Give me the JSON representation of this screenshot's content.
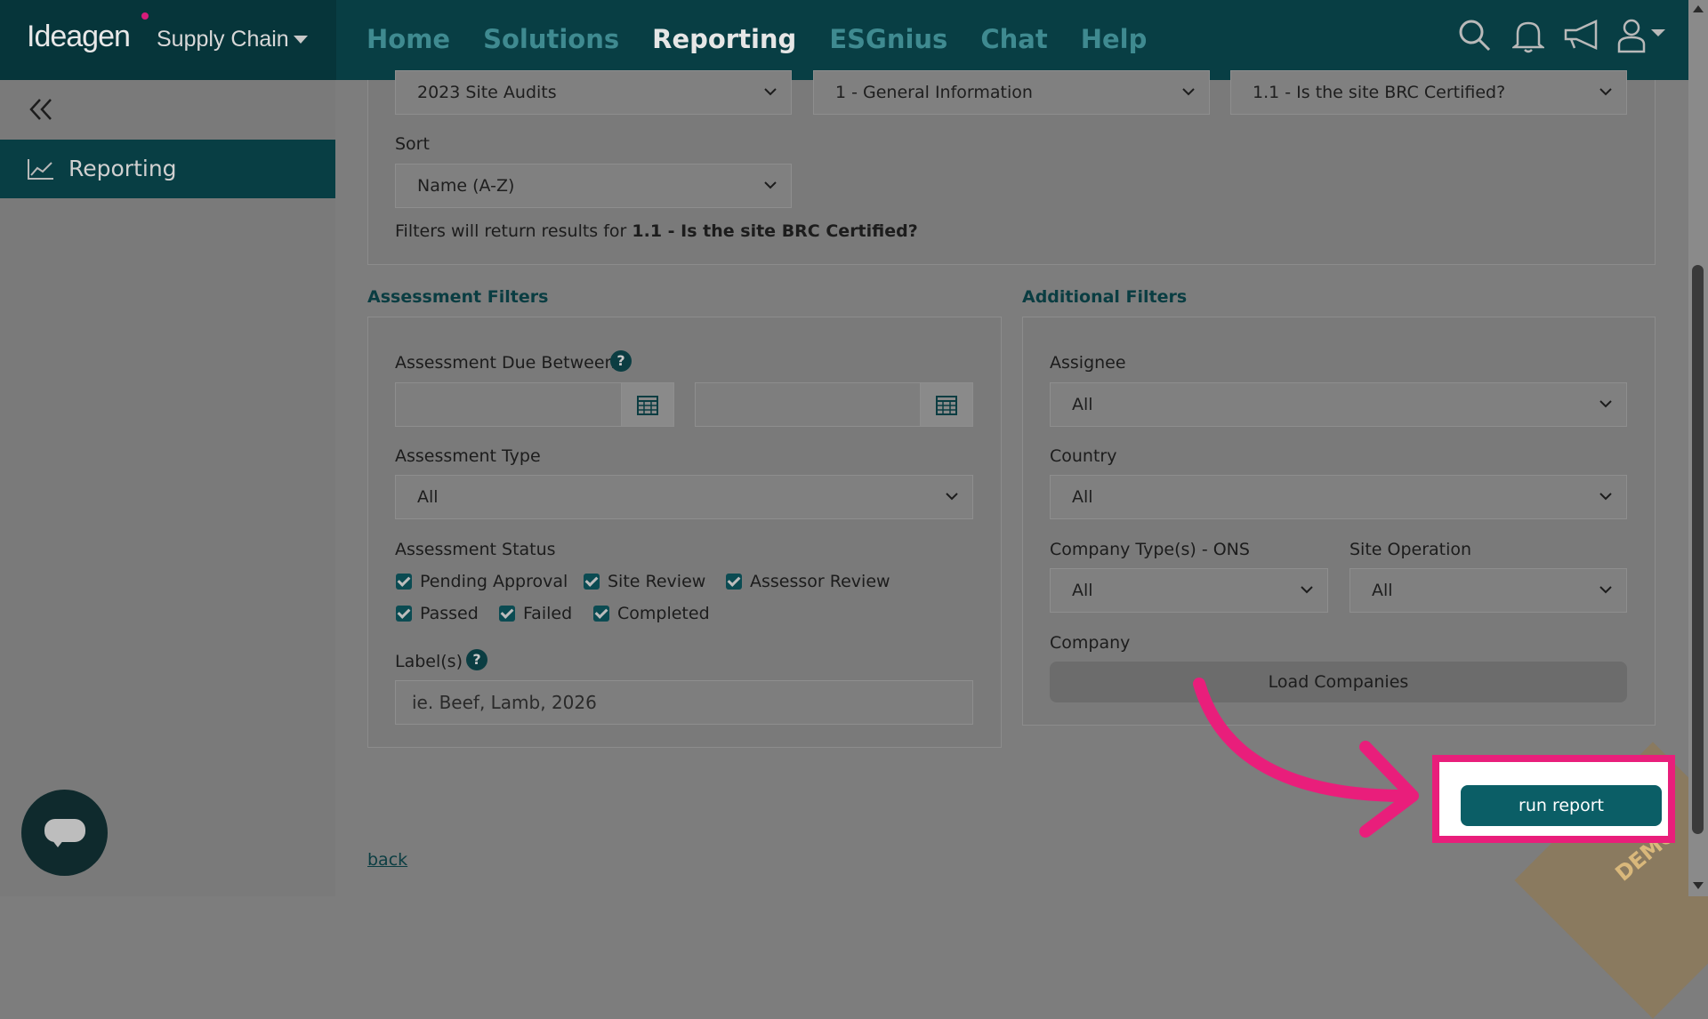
{
  "brand": {
    "name": "Ideagen",
    "product": "Supply Chain"
  },
  "nav": {
    "items": [
      "Home",
      "Solutions",
      "Reporting",
      "ESGnius",
      "Chat",
      "Help"
    ],
    "active": "Reporting"
  },
  "sidebar": {
    "item_label": "Reporting"
  },
  "report": {
    "select1": "2023 Site Audits",
    "select2": "1 - General Information",
    "select3": "1.1 - Is the site BRC Certified?",
    "sort_label": "Sort",
    "sort_value": "Name (A-Z)",
    "filter_note_prefix": "Filters will return results for ",
    "filter_note_bold": "1.1 - Is the site BRC Certified?"
  },
  "assessment": {
    "title": "Assessment Filters",
    "due_label": "Assessment Due Between",
    "type_label": "Assessment Type",
    "type_value": "All",
    "status_label": "Assessment Status",
    "statuses": [
      "Pending Approval",
      "Site Review",
      "Assessor Review",
      "Passed",
      "Failed",
      "Completed"
    ],
    "labels_label": "Label(s)",
    "labels_placeholder": "ie. Beef, Lamb, 2026"
  },
  "additional": {
    "title": "Additional Filters",
    "assignee_label": "Assignee",
    "assignee_value": "All",
    "country_label": "Country",
    "country_value": "All",
    "company_type_label": "Company Type(s) - ONS",
    "company_type_value": "All",
    "site_op_label": "Site Operation",
    "site_op_value": "All",
    "company_label": "Company",
    "load_companies": "Load Companies"
  },
  "actions": {
    "run_report": "run report",
    "back": "back"
  },
  "overlay": {
    "watermark": "DEMO"
  },
  "colors": {
    "nav_bg": "#083e44",
    "accent": "#0b5e66",
    "highlight": "#e91e7b"
  }
}
